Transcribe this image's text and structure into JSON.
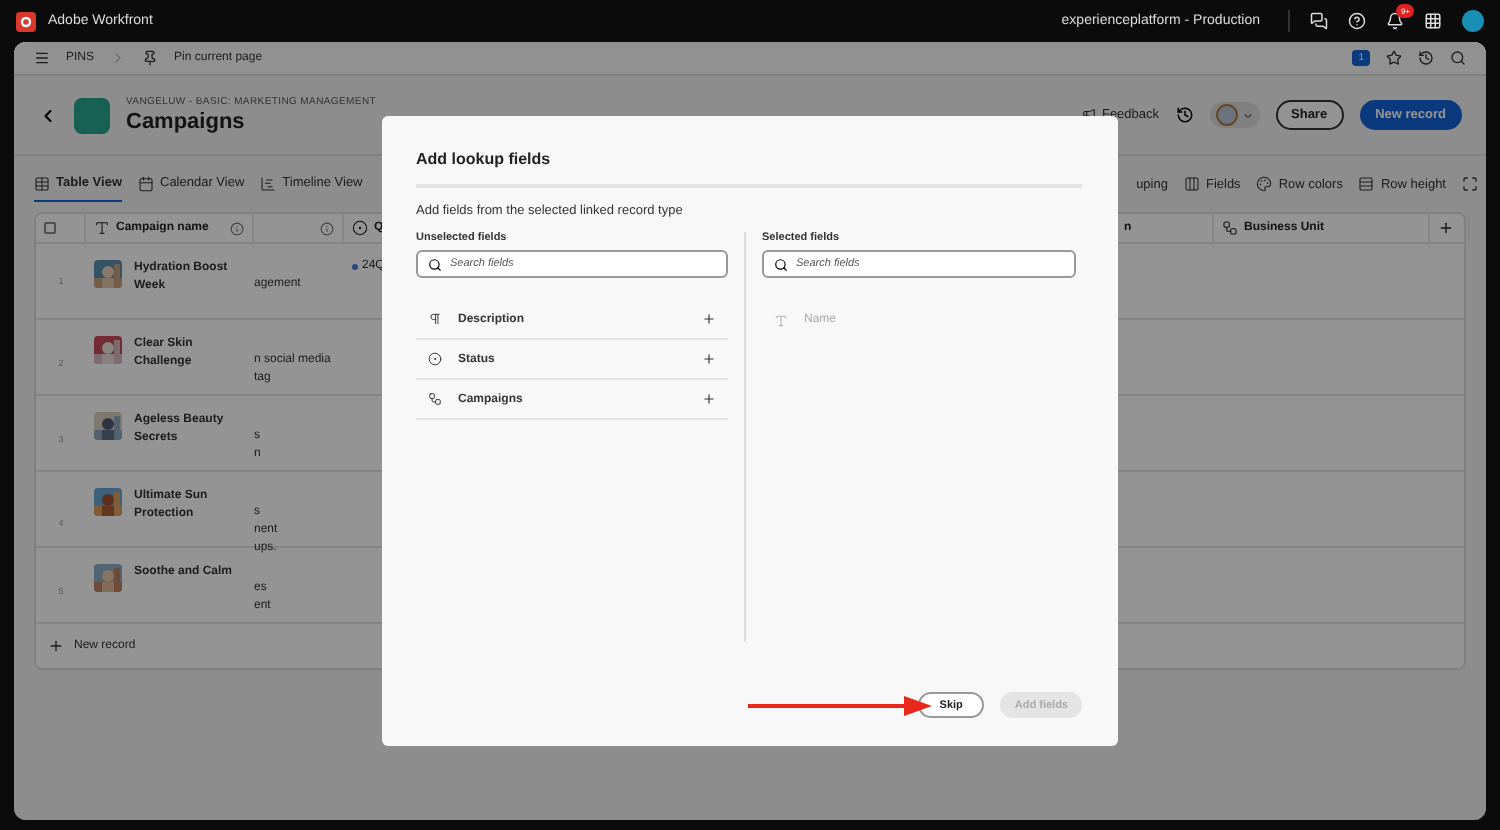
{
  "topbar": {
    "app_name": "Adobe Workfront",
    "environment": "experienceplatform - Production",
    "notifications": "9+"
  },
  "pins_bar": {
    "label": "PINS",
    "pin_action": "Pin current page",
    "badge": "1"
  },
  "header": {
    "workspace": "VANGELUW - BASIC: MARKETING MANAGEMENT",
    "title": "Campaigns",
    "feedback": "Feedback",
    "share": "Share",
    "new_record": "New record"
  },
  "view_tabs": [
    {
      "label": "Table View",
      "selected": true
    },
    {
      "label": "Calendar View",
      "selected": false
    },
    {
      "label": "Timeline View",
      "selected": false
    }
  ],
  "toolbar_actions": [
    {
      "label": "uping"
    },
    {
      "label": "Fields"
    },
    {
      "label": "Row colors"
    },
    {
      "label": "Row height"
    }
  ],
  "table": {
    "select_all_checked": false,
    "columns": [
      {
        "label": "Campaign name"
      },
      {},
      {
        "label": "Q"
      },
      {
        "label": "n"
      },
      {
        "label": "Business Unit"
      }
    ],
    "rows": [
      {
        "number": "1",
        "name": "Hydration Boost Week",
        "column_2": [
          "agement"
        ],
        "column_3": "24Q"
      },
      {
        "number": "2",
        "name": "Clear Skin Challenge",
        "column_2": [
          "n social media",
          "tag"
        ]
      },
      {
        "number": "3",
        "name": "Ageless Beauty Secrets",
        "column_2": [
          "s",
          "n"
        ]
      },
      {
        "number": "4",
        "name": "Ultimate Sun Protection",
        "column_2": [
          "s",
          "nent",
          "ups."
        ]
      },
      {
        "number": "5",
        "name": "Soothe and Calm",
        "column_2": [
          "es",
          "ent"
        ]
      }
    ],
    "new_record": "New record"
  },
  "dialog": {
    "title": "Add lookup fields",
    "description": "Add fields from the selected linked record type",
    "unselected": {
      "label": "Unselected fields",
      "placeholder": "Search fields",
      "items": [
        {
          "label": "Description"
        },
        {
          "label": "Status"
        },
        {
          "label": "Campaigns"
        }
      ]
    },
    "selected": {
      "label": "Selected fields",
      "placeholder": "Search fields",
      "items": [
        {
          "label": "Name",
          "disabled": true
        }
      ]
    },
    "buttons": [
      {
        "label": "Skip",
        "disabled": false
      },
      {
        "label": "Add fields",
        "disabled": true
      }
    ]
  }
}
